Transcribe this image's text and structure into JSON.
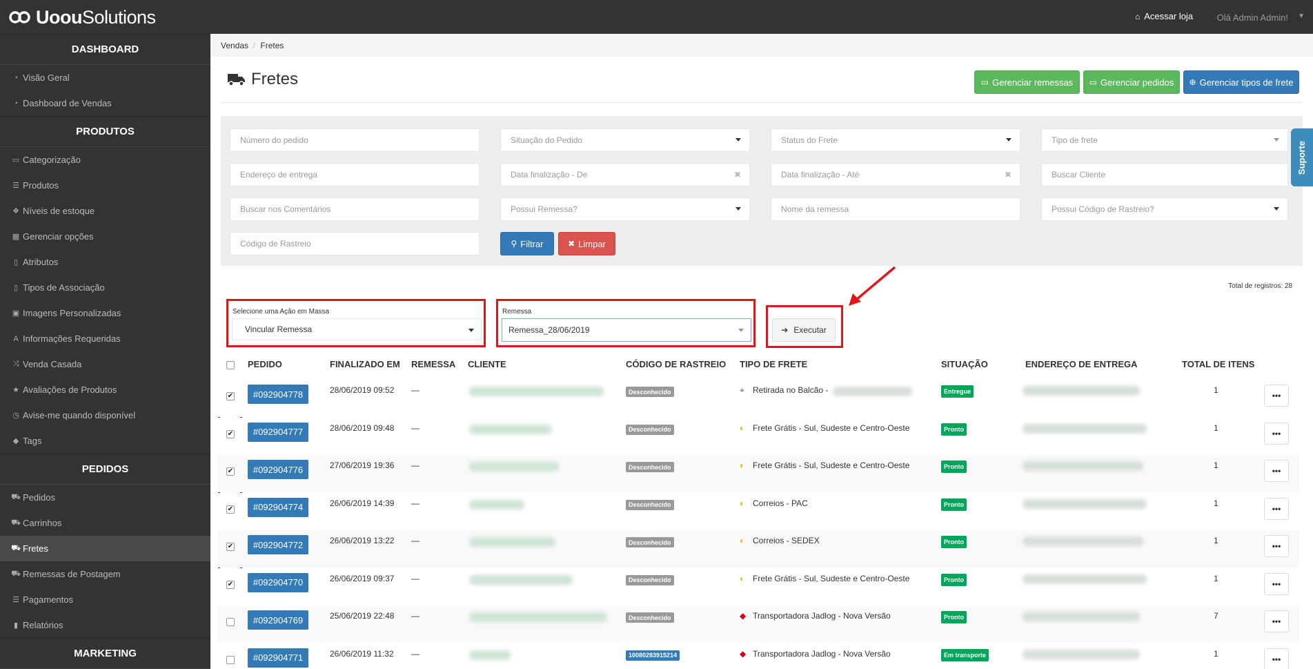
{
  "app": {
    "brand_bold": "Uoou",
    "brand_light": "Solutions",
    "store_link": "Acessar loja",
    "greeting": "Olá Admin Admin!"
  },
  "sidebar": {
    "sections": [
      {
        "title": "DASHBOARD",
        "items": [
          {
            "label": "Visão Geral",
            "icon": "dashboard-icon"
          },
          {
            "label": "Dashboard de Vendas",
            "icon": "dashboard-icon"
          }
        ]
      },
      {
        "title": "PRODUTOS",
        "items": [
          {
            "label": "Categorização",
            "icon": "folder-icon"
          },
          {
            "label": "Produtos",
            "icon": "list-icon"
          },
          {
            "label": "Níveis de estoque",
            "icon": "cubes-icon"
          },
          {
            "label": "Gerenciar opções",
            "icon": "grid-icon"
          },
          {
            "label": "Atributos",
            "icon": "file-icon"
          },
          {
            "label": "Tipos de Associação",
            "icon": "file-icon"
          },
          {
            "label": "Imagens Personalizadas",
            "icon": "image-icon"
          },
          {
            "label": "Informações Requeridas",
            "icon": "font-icon"
          },
          {
            "label": "Venda Casada",
            "icon": "random-icon"
          },
          {
            "label": "Avaliações de Produtos",
            "icon": "star-icon"
          },
          {
            "label": "Avise-me quando disponível",
            "icon": "clock-icon"
          },
          {
            "label": "Tags",
            "icon": "tag-icon"
          }
        ]
      },
      {
        "title": "PEDIDOS",
        "items": [
          {
            "label": "Pedidos",
            "icon": "cart-icon"
          },
          {
            "label": "Carrinhos",
            "icon": "cart-icon"
          },
          {
            "label": "Fretes",
            "icon": "truck-icon",
            "active": true
          },
          {
            "label": "Remessas de Postagem",
            "icon": "truck-icon"
          },
          {
            "label": "Pagamentos",
            "icon": "list-icon"
          },
          {
            "label": "Relatórios",
            "icon": "bar-chart-icon"
          }
        ]
      },
      {
        "title": "MARKETING",
        "items": []
      }
    ]
  },
  "breadcrumb": [
    "Vendas",
    "Fretes"
  ],
  "page": {
    "title": "Fretes",
    "buttons": {
      "manage_shipments": "Gerenciar remessas",
      "manage_orders": "Gerenciar pedidos",
      "manage_freight_types": "Gerenciar tipos de frete"
    }
  },
  "filters": {
    "order_number": "Número do pedido",
    "order_status": "Situação do Pedido",
    "freight_status": "Status do Frete",
    "freight_type": "Tipo de frete",
    "delivery_address": "Endereço de entrega",
    "date_from": "Data finalização - De",
    "date_to": "Data finalização - Até",
    "search_client": "Buscar Cliente",
    "search_comments": "Buscar nos Comentários",
    "has_shipment": "Possui Remessa?",
    "shipment_name": "Nome da remessa",
    "has_tracking": "Possui Código de Rastreio?",
    "tracking_code": "Código de Rastreio",
    "filter_button": "Filtrar",
    "clear_button": "Limpar"
  },
  "support_tab": "Suporte",
  "total_records": "Total de registros: 28",
  "mass_action": {
    "action_label": "Selecione uma Ação em Massa",
    "action_value": "Vincular Remessa",
    "shipment_label": "Remessa",
    "shipment_value": "Remessa_28/06/2019",
    "execute_button": "Executar",
    "highlight_color": "#e0161b"
  },
  "table": {
    "headers": [
      "PEDIDO",
      "FINALIZADO EM",
      "REMESSA",
      "CLIENTE",
      "CÓDIGO DE RASTREIO",
      "TIPO DE FRETE",
      "SITUAÇÃO",
      "ENDEREÇO DE ENTREGA",
      "TOTAL DE ITENS"
    ],
    "rows": [
      {
        "checked": true,
        "order": "#092904778",
        "finalized": "28/06/2019 09:52",
        "shipment": "—",
        "tracking": "Desconhecido",
        "tracking_style": "gray",
        "freight": "Retirada no Balcão -",
        "freight_icon": "map-pin-icon",
        "status": "Entregue",
        "items": "1"
      },
      {
        "checked": true,
        "order": "#092904777",
        "finalized": "28/06/2019 09:48",
        "shipment": "—",
        "tracking": "Desconhecido",
        "tracking_style": "gray",
        "freight": "Frete Grátis - Sul, Sudeste e Centro-Oeste",
        "freight_icon": "correios-icon",
        "status": "Pronto",
        "items": "1"
      },
      {
        "checked": true,
        "order": "#092904776",
        "finalized": "27/06/2019 19:36",
        "shipment": "—",
        "tracking": "Desconhecido",
        "tracking_style": "gray",
        "freight": "Frete Grátis - Sul, Sudeste e Centro-Oeste",
        "freight_icon": "correios-icon",
        "status": "Pronto",
        "items": "1"
      },
      {
        "checked": true,
        "order": "#092904774",
        "finalized": "26/06/2019 14:39",
        "shipment": "—",
        "tracking": "Desconhecido",
        "tracking_style": "gray",
        "freight": "Correios - PAC",
        "freight_icon": "correios-icon",
        "status": "Pronto",
        "items": "1"
      },
      {
        "checked": true,
        "order": "#092904772",
        "finalized": "26/06/2019 13:22",
        "shipment": "—",
        "tracking": "Desconhecido",
        "tracking_style": "gray",
        "freight": "Correios - SEDEX",
        "freight_icon": "correios-icon",
        "status": "Pronto",
        "items": "1"
      },
      {
        "checked": true,
        "order": "#092904770",
        "finalized": "26/06/2019 09:37",
        "shipment": "—",
        "tracking": "Desconhecido",
        "tracking_style": "gray",
        "freight": "Frete Grátis - Sul, Sudeste e Centro-Oeste",
        "freight_icon": "correios-icon",
        "status": "Pronto",
        "items": "1"
      },
      {
        "checked": false,
        "order": "#092904769",
        "finalized": "25/06/2019 22:48",
        "shipment": "—",
        "tracking": "Desconhecido",
        "tracking_style": "gray",
        "freight": "Transportadora Jadlog - Nova Versão",
        "freight_icon": "jadlog-icon",
        "status": "Pronto",
        "items": "7"
      },
      {
        "checked": false,
        "order": "#092904771",
        "finalized": "26/06/2019 11:32",
        "shipment": "—",
        "tracking": "10080283915214",
        "tracking_style": "blue",
        "freight": "Transportadora Jadlog - Nova Versão",
        "freight_icon": "jadlog-icon",
        "status": "Em transporte",
        "items": "1"
      }
    ],
    "more_button": "•••"
  }
}
